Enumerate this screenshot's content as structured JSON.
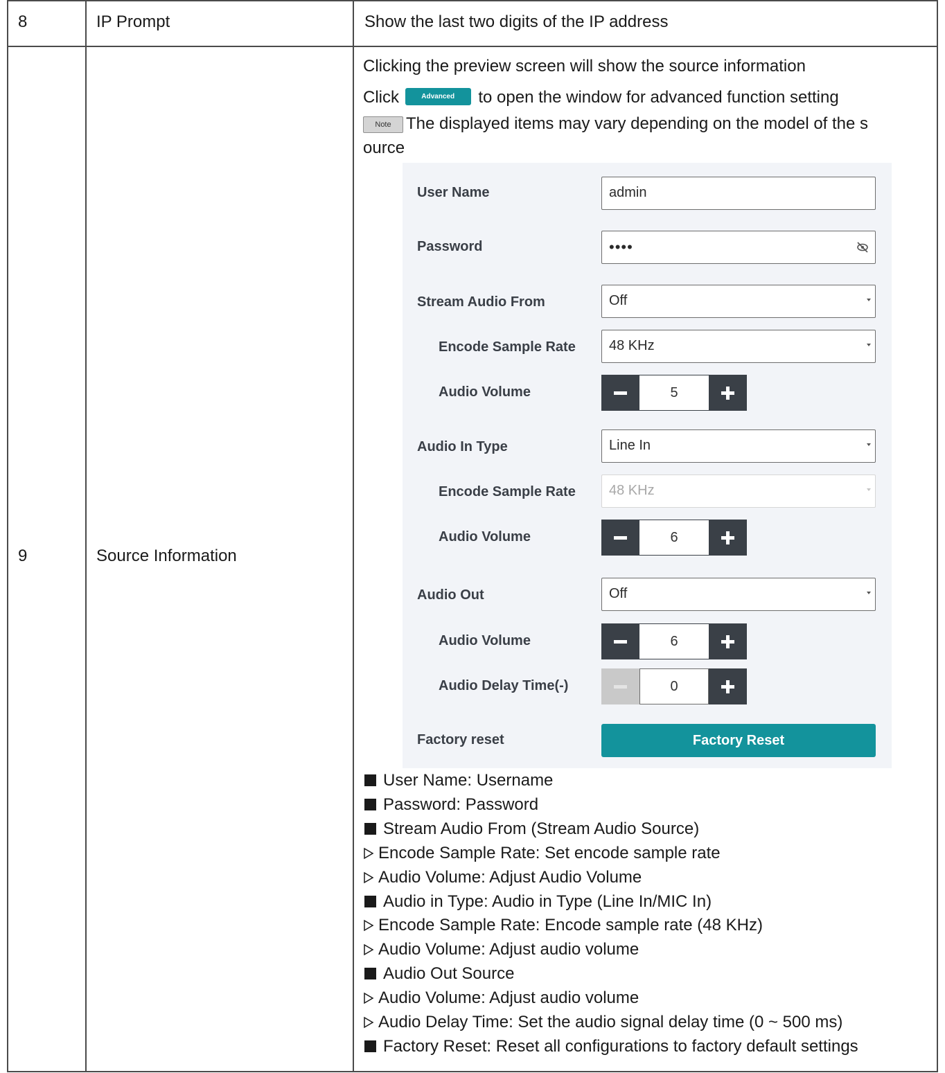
{
  "rows": [
    {
      "number": "8",
      "item": "IP Prompt",
      "description": "Show the last two digits of the IP address"
    },
    {
      "number": "9",
      "item": "Source Information",
      "intro": "Clicking the preview screen will show the source information",
      "click_prefix": "Click",
      "advanced_button": "Advanced",
      "click_suffix": "to open the window for advanced function setting",
      "note_tag": "Note",
      "note_text_1": "The displayed items may vary depending on the model of the s",
      "note_text_2": "ource",
      "panel": {
        "user_name_label": "User Name",
        "user_name_value": "admin",
        "password_label": "Password",
        "password_value": "••••",
        "password_icon": "eye-slash-icon",
        "stream_audio_from_label": "Stream Audio From",
        "stream_audio_from_value": "Off",
        "encode_rate_1_label": "Encode Sample Rate",
        "encode_rate_1_value": "48 KHz",
        "audio_volume_1_label": "Audio Volume",
        "audio_volume_1_value": "5",
        "audio_in_type_label": "Audio In Type",
        "audio_in_type_value": "Line In",
        "encode_rate_2_label": "Encode Sample Rate",
        "encode_rate_2_value": "48 KHz",
        "audio_volume_2_label": "Audio Volume",
        "audio_volume_2_value": "6",
        "audio_out_label": "Audio Out",
        "audio_out_value": "Off",
        "audio_volume_3_label": "Audio Volume",
        "audio_volume_3_value": "6",
        "audio_delay_label": "Audio Delay Time(-)",
        "audio_delay_value": "0",
        "factory_reset_label": "Factory reset",
        "factory_reset_button": "Factory Reset",
        "accent_color": "#13939c"
      },
      "bullets": [
        {
          "marker": "square",
          "text": "User Name: Username"
        },
        {
          "marker": "square",
          "text": "Password: Password"
        },
        {
          "marker": "square",
          "text": "Stream Audio From (Stream Audio Source)"
        },
        {
          "marker": "triangle",
          "text": "Encode Sample Rate: Set encode sample rate"
        },
        {
          "marker": "triangle",
          "text": "Audio Volume: Adjust Audio Volume"
        },
        {
          "marker": "square",
          "text": "Audio in Type: Audio in Type (Line In/MIC In)"
        },
        {
          "marker": "triangle",
          "text": "Encode Sample Rate: Encode sample rate (48 KHz)"
        },
        {
          "marker": "triangle",
          "text": "Audio Volume: Adjust audio volume"
        },
        {
          "marker": "square",
          "text": "Audio Out Source"
        },
        {
          "marker": "triangle",
          "text": "Audio Volume: Adjust audio volume"
        },
        {
          "marker": "triangle",
          "text": "Audio Delay Time: Set the audio signal delay time (0 ~ 500 ms)"
        },
        {
          "marker": "square",
          "text": "Factory Reset: Reset all configurations to factory default settings"
        }
      ]
    }
  ]
}
